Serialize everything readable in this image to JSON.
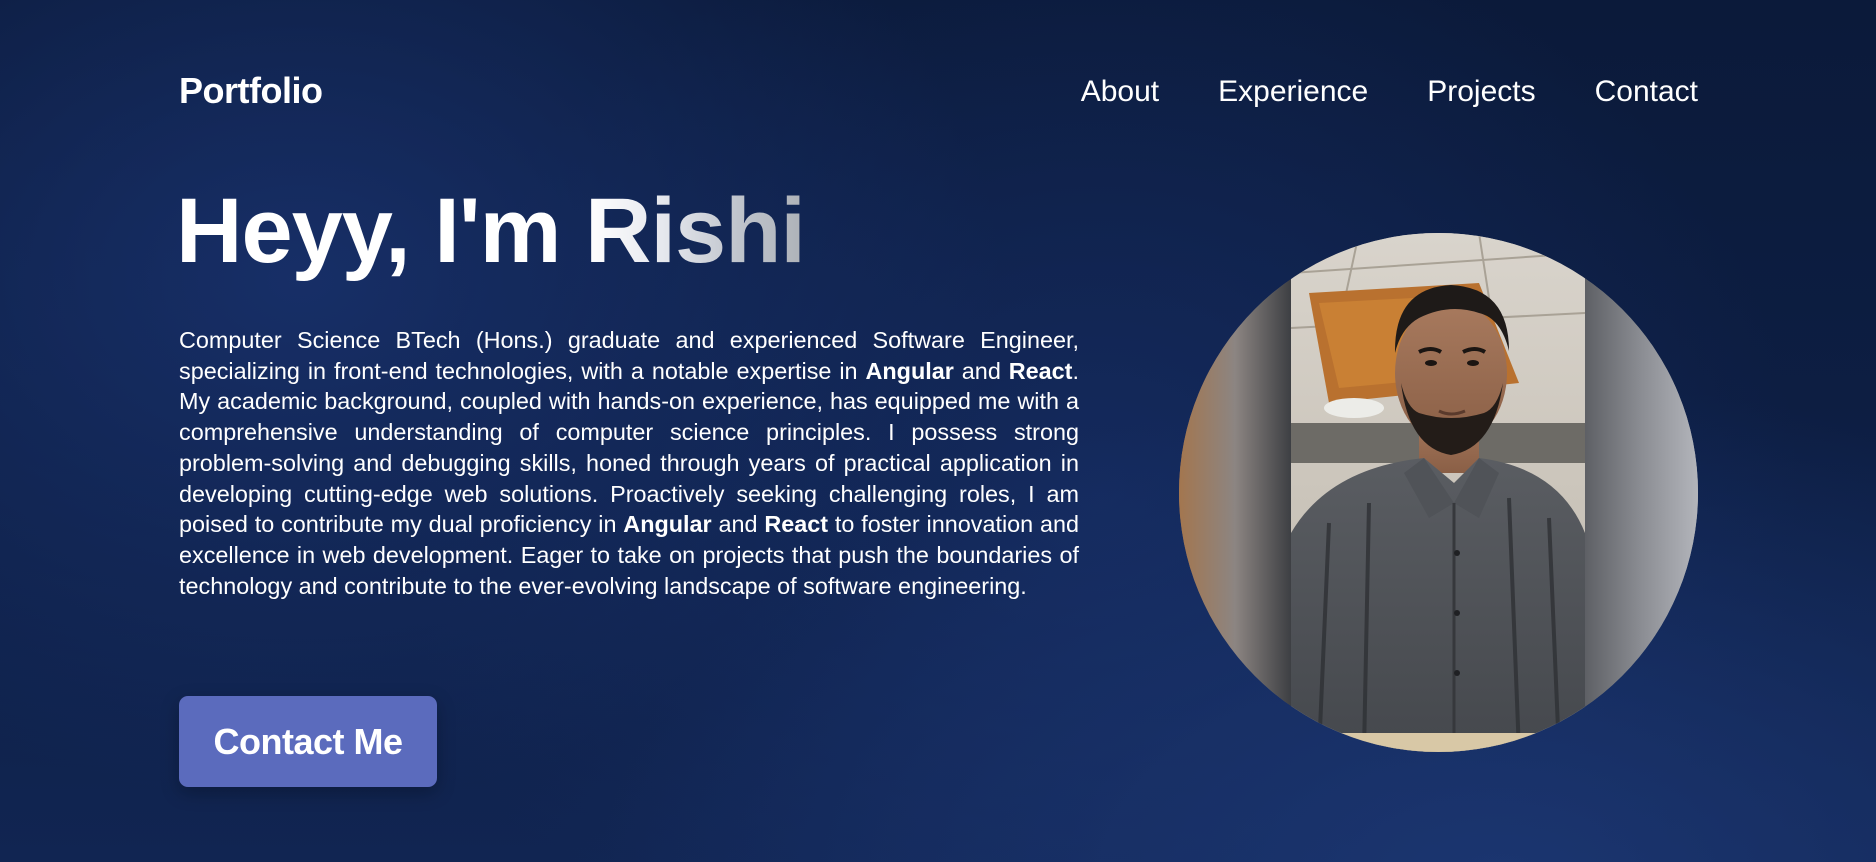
{
  "nav": {
    "logo": "Portfolio",
    "links": [
      "About",
      "Experience",
      "Projects",
      "Contact"
    ]
  },
  "hero": {
    "greeting": "Heyy, I'm ",
    "name_start": "Ri",
    "name_end": "shi",
    "bio": {
      "p1": "Computer Science BTech (Hons.) graduate and experienced Software Engineer, specializing in front-end technologies, with a notable expertise in ",
      "tech1": "Angular",
      "p2": " and ",
      "tech2": "React",
      "p3": ". My academic background, coupled with hands-on experience, has equipped me with a comprehensive understanding of computer science principles. I possess strong problem-solving and debugging skills, honed through years of practical application in developing cutting-edge web solutions. Proactively seeking challenging roles, I am poised to contribute my dual proficiency in ",
      "tech3": "Angular",
      "p4": " and ",
      "tech4": "React",
      "p5": " to foster innovation and excellence in web development. Eager to take on projects that push the boundaries of technology and contribute to the ever-evolving landscape of software engineering."
    },
    "cta_label": "Contact Me"
  },
  "colors": {
    "background": "#0d1e43",
    "button": "#5b6bbd",
    "text": "#ffffff"
  }
}
